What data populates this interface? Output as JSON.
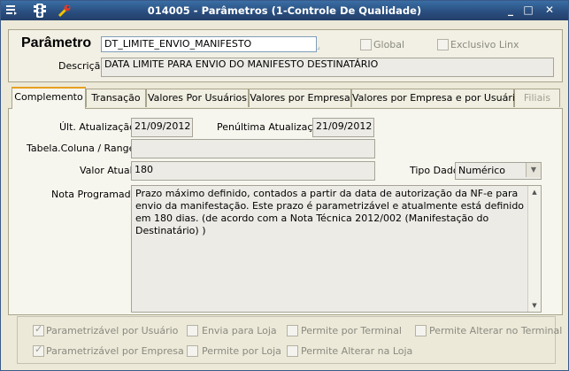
{
  "window": {
    "title": "014005 - Parâmetros (1-Controle De Qualidade)",
    "icons": [
      "menu-icon",
      "traffic-light-icon",
      "wrench-icon"
    ],
    "buttons": [
      "minimize",
      "maximize",
      "close"
    ]
  },
  "header": {
    "parametro_label": "Parâmetro",
    "parametro_value": "DT_LIMITE_ENVIO_MANIFESTO",
    "global_label": "Global",
    "exclusivo_label": "Exclusivo Linx",
    "descricao_label": "Descrição",
    "descricao_value": "DATA LIMITE PARA ENVIO DO MANIFESTO DESTINATÁRIO"
  },
  "tabs": [
    {
      "label": "Complemento"
    },
    {
      "label": "Transação"
    },
    {
      "label": "Valores Por Usuários"
    },
    {
      "label": "Valores por Empresa"
    },
    {
      "label": "Valores por Empresa e por Usuário"
    },
    {
      "label": "Filiais"
    }
  ],
  "complemento": {
    "ult_atualizacao_label": "Últ. Atualização",
    "ult_atualizacao_value": "21/09/2012",
    "penultima_label": "Penúltima Atualização",
    "penultima_value": "21/09/2012",
    "tabela_coluna_label": "Tabela.Coluna / Range",
    "tabela_coluna_value": "",
    "valor_atual_label": "Valor Atual",
    "valor_atual_value": "180",
    "tipo_dado_label": "Tipo Dado",
    "tipo_dado_value": "Numérico",
    "nota_label": "Nota Programador",
    "nota_value": "Prazo máximo definido, contados a partir da data de autorização da NF-e para envio da manifestação.  Este prazo é parametrizável e atualmente está definido em 180 dias. (de acordo com a Nota Técnica 2012/002 (Manifestação do Destinatário) )"
  },
  "options": {
    "parametrizavel_usuario": "Parametrizável por Usuário",
    "envia_loja": "Envia para Loja",
    "permite_terminal": "Permite por Terminal",
    "permite_alterar_terminal": "Permite Alterar no Terminal",
    "parametrizavel_empresa": "Parametrizável por Empresa",
    "permite_loja": "Permite por Loja",
    "permite_alterar_loja": "Permite Alterar na Loja"
  }
}
